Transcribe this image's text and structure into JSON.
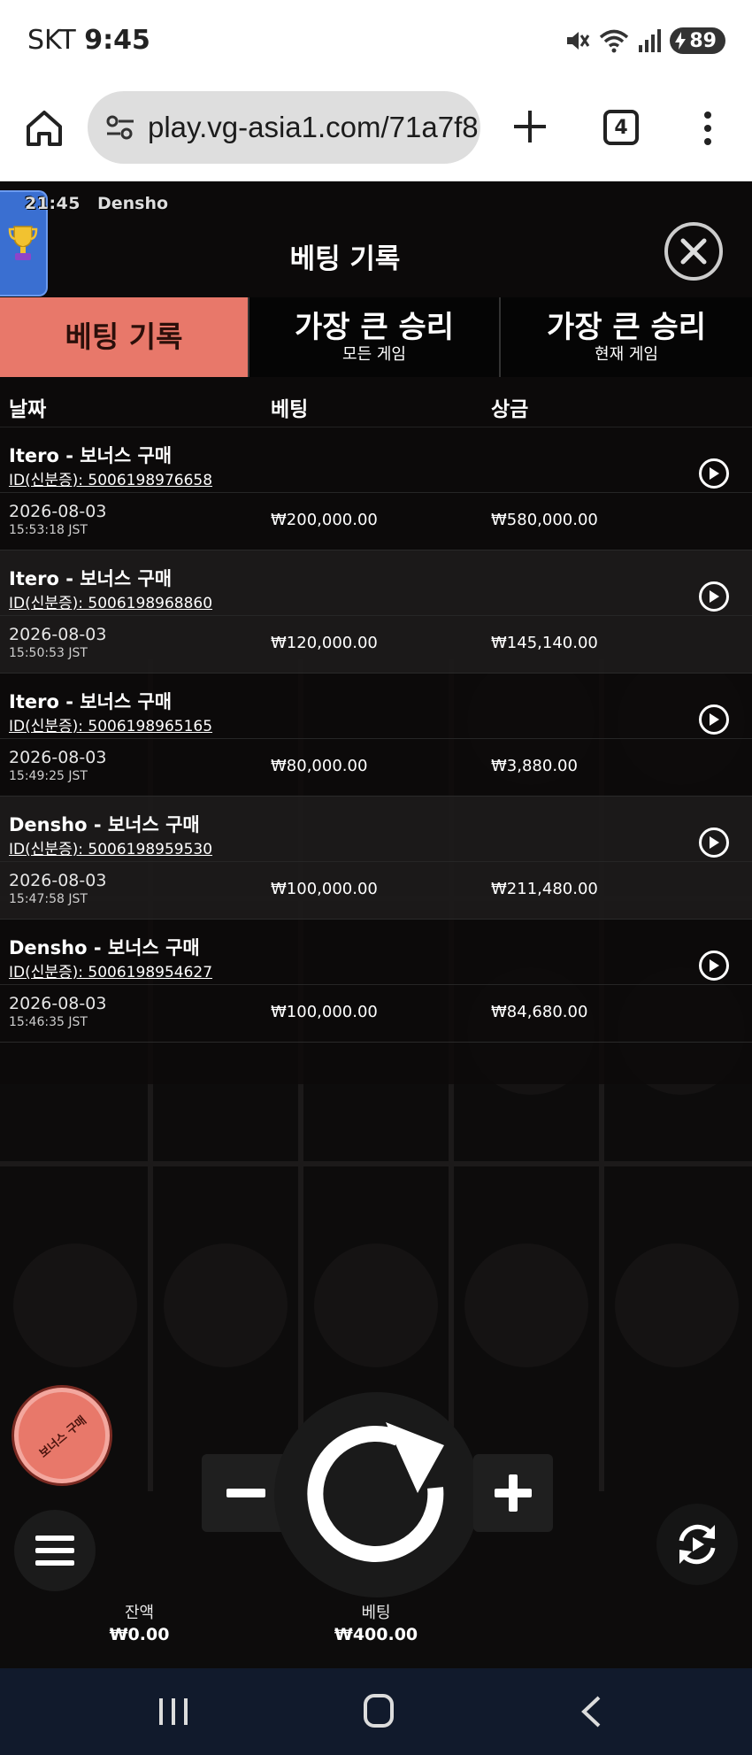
{
  "status_bar": {
    "carrier": "SKT",
    "time": "9:45",
    "battery": "89"
  },
  "browser": {
    "url": "play.vg-asia1.com/71a7f8",
    "tab_count": "4"
  },
  "game": {
    "clock": "21:45",
    "name": "Densho"
  },
  "panel": {
    "title": "베팅 기록",
    "tabs": [
      {
        "label": "베팅 기록",
        "sub": ""
      },
      {
        "label": "가장 큰 승리",
        "sub": "모든 게임"
      },
      {
        "label": "가장 큰 승리",
        "sub": "현재 게임"
      }
    ],
    "columns": {
      "date": "날짜",
      "bet": "베팅",
      "win": "상금"
    },
    "rows": [
      {
        "title": "Itero - 보너스 구매",
        "id": "ID(신분증): 5006198976658",
        "date": "2026-08-03",
        "time": "15:53:18 JST",
        "bet": "₩200,000.00",
        "win": "₩580,000.00"
      },
      {
        "title": "Itero - 보너스 구매",
        "id": "ID(신분증): 5006198968860",
        "date": "2026-08-03",
        "time": "15:50:53 JST",
        "bet": "₩120,000.00",
        "win": "₩145,140.00"
      },
      {
        "title": "Itero - 보너스 구매",
        "id": "ID(신분증): 5006198965165",
        "date": "2026-08-03",
        "time": "15:49:25 JST",
        "bet": "₩80,000.00",
        "win": "₩3,880.00"
      },
      {
        "title": "Densho - 보너스 구매",
        "id": "ID(신분증): 5006198959530",
        "date": "2026-08-03",
        "time": "15:47:58 JST",
        "bet": "₩100,000.00",
        "win": "₩211,480.00"
      },
      {
        "title": "Densho - 보너스 구매",
        "id": "ID(신분증): 5006198954627",
        "date": "2026-08-03",
        "time": "15:46:35 JST",
        "bet": "₩100,000.00",
        "win": "₩84,680.00"
      }
    ]
  },
  "controls": {
    "bonus_buy": "보너스 구매",
    "balance_label": "잔액",
    "balance_value": "₩0.00",
    "bet_label": "베팅",
    "bet_value": "₩400.00"
  },
  "colors": {
    "accent": "#e8786a",
    "panel_bg": "#0a0909",
    "nav_bg": "#111a2c"
  }
}
